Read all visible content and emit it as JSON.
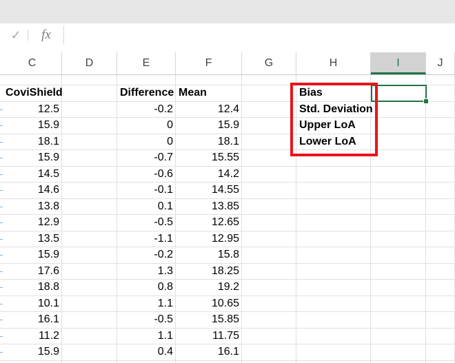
{
  "formula_bar": {
    "check_icon": "✓",
    "fx_label": "fx",
    "value": ""
  },
  "columns": [
    "C",
    "D",
    "E",
    "F",
    "G",
    "H",
    "I",
    "J"
  ],
  "selected_column": "I",
  "headers": {
    "covishield": "CoviShield",
    "difference": "Difference",
    "mean": "Mean"
  },
  "rows": [
    {
      "covishield": "12.5",
      "difference": "-0.2",
      "mean": "12.4"
    },
    {
      "covishield": "15.9",
      "difference": "0",
      "mean": "15.9"
    },
    {
      "covishield": "18.1",
      "difference": "0",
      "mean": "18.1"
    },
    {
      "covishield": "15.9",
      "difference": "-0.7",
      "mean": "15.55"
    },
    {
      "covishield": "14.5",
      "difference": "-0.6",
      "mean": "14.2"
    },
    {
      "covishield": "14.6",
      "difference": "-0.1",
      "mean": "14.55"
    },
    {
      "covishield": "13.8",
      "difference": "0.1",
      "mean": "13.85"
    },
    {
      "covishield": "12.9",
      "difference": "-0.5",
      "mean": "12.65"
    },
    {
      "covishield": "13.5",
      "difference": "-1.1",
      "mean": "12.95"
    },
    {
      "covishield": "15.9",
      "difference": "-0.2",
      "mean": "15.8"
    },
    {
      "covishield": "17.6",
      "difference": "1.3",
      "mean": "18.25"
    },
    {
      "covishield": "18.8",
      "difference": "0.8",
      "mean": "19.2"
    },
    {
      "covishield": "10.1",
      "difference": "1.1",
      "mean": "10.65"
    },
    {
      "covishield": "16.1",
      "difference": "-0.5",
      "mean": "15.85"
    },
    {
      "covishield": "11.2",
      "difference": "1.1",
      "mean": "11.75"
    },
    {
      "covishield": "15.9",
      "difference": "0.4",
      "mean": "16.1"
    }
  ],
  "stats_labels": [
    "Bias",
    "Std. Deviation",
    "Upper LoA",
    "Lower LoA"
  ],
  "colors": {
    "accent": "#217346",
    "highlight_box": "#e8141b"
  }
}
